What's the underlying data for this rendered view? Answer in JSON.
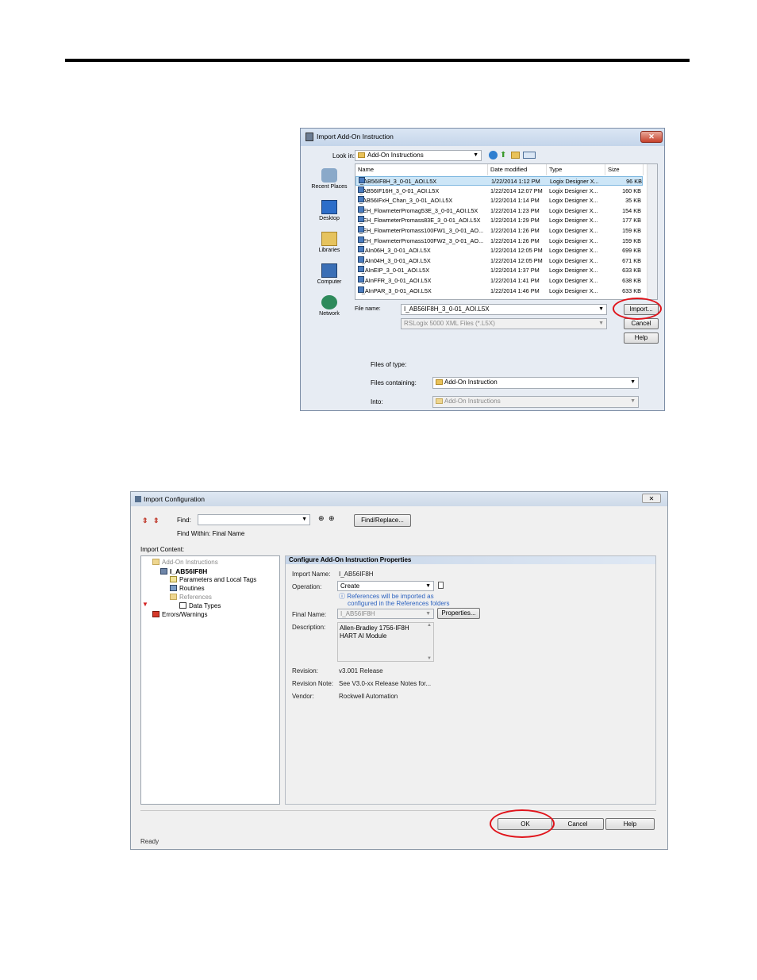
{
  "dialog1": {
    "title": "Import Add-On Instruction",
    "look_in_label": "Look in:",
    "look_in_value": "Add-On Instructions",
    "places": [
      {
        "label": "Recent Places",
        "icon": "recent-places-icon"
      },
      {
        "label": "Desktop",
        "icon": "desktop-icon"
      },
      {
        "label": "Libraries",
        "icon": "libraries-icon"
      },
      {
        "label": "Computer",
        "icon": "computer-icon"
      },
      {
        "label": "Network",
        "icon": "network-icon"
      }
    ],
    "columns": [
      "Name",
      "Date modified",
      "Type",
      "Size"
    ],
    "files": [
      {
        "name": "I_AB56IF8H_3_0-01_AOI.L5X",
        "date": "1/22/2014 1:12 PM",
        "type": "Logix Designer X...",
        "size": "96 KB"
      },
      {
        "name": "I_AB56IF16H_3_0-01_AOI.L5X",
        "date": "1/22/2014 12:07 PM",
        "type": "Logix Designer X...",
        "size": "160 KB"
      },
      {
        "name": "I_AB56IFxH_Chan_3_0-01_AOI.L5X",
        "date": "1/22/2014 1:14 PM",
        "type": "Logix Designer X...",
        "size": "35 KB"
      },
      {
        "name": "I_EH_FlowmeterPromag53E_3_0-01_AOI.L5X",
        "date": "1/22/2014 1:23 PM",
        "type": "Logix Designer X...",
        "size": "154 KB"
      },
      {
        "name": "I_EH_FlowmeterPromass83E_3_0-01_AOI.L5X",
        "date": "1/22/2014 1:29 PM",
        "type": "Logix Designer X...",
        "size": "177 KB"
      },
      {
        "name": "I_EH_FlowmeterPromass100FW1_3_0-01_AO...",
        "date": "1/22/2014 1:26 PM",
        "type": "Logix Designer X...",
        "size": "159 KB"
      },
      {
        "name": "I_EH_FlowmeterPromass100FW2_3_0-01_AO...",
        "date": "1/22/2014 1:26 PM",
        "type": "Logix Designer X...",
        "size": "159 KB"
      },
      {
        "name": "P_AIn06H_3_0-01_AOI.L5X",
        "date": "1/22/2014 12:05 PM",
        "type": "Logix Designer X...",
        "size": "699 KB"
      },
      {
        "name": "P_AIn04H_3_0-01_AOI.L5X",
        "date": "1/22/2014 12:05 PM",
        "type": "Logix Designer X...",
        "size": "671 KB"
      },
      {
        "name": "P_AInEIP_3_0-01_AOI.L5X",
        "date": "1/22/2014 1:37 PM",
        "type": "Logix Designer X...",
        "size": "633 KB"
      },
      {
        "name": "P_AInFFR_3_0-01_AOI.L5X",
        "date": "1/22/2014 1:41 PM",
        "type": "Logix Designer X...",
        "size": "638 KB"
      },
      {
        "name": "P_AInPAR_3_0-01_AOI.L5X",
        "date": "1/22/2014 1:46 PM",
        "type": "Logix Designer X...",
        "size": "633 KB"
      }
    ],
    "file_name_label": "File name:",
    "file_name_value": "I_AB56IF8H_3_0-01_AOI.L5X",
    "file_type_value": "RSLogix 5000 XML Files (*.L5X)",
    "import_label": "Import...",
    "cancel_label": "Cancel",
    "help_label": "Help",
    "files_of_type_label": "Files of type:",
    "files_containing_label": "Files containing:",
    "files_containing_value": "Add-On Instruction",
    "into_label": "Into:",
    "into_value": "Add-On Instructions"
  },
  "dialog2": {
    "title": "Import Configuration",
    "find_label": "Find:",
    "find_value": "",
    "find_replace_label": "Find/Replace...",
    "find_within": "Find Within: Final Name",
    "import_content_label": "Import Content:",
    "tree": {
      "root": "Add-On Instructions",
      "aoi": "I_AB56IF8H",
      "params": "Parameters and Local Tags",
      "routines": "Routines",
      "references": "References",
      "data_types": "Data Types",
      "errors": "Errors/Warnings"
    },
    "panel_title": "Configure Add-On Instruction Properties",
    "import_name_label": "Import Name:",
    "import_name_value": "I_AB56IF8H",
    "operation_label": "Operation:",
    "operation_value": "Create",
    "info_line1": "References will be imported as",
    "info_line2": "configured in the References folders",
    "final_name_label": "Final Name:",
    "final_name_value": "I_AB56IF8H",
    "properties_label": "Properties...",
    "description_label": "Description:",
    "description_line1": "Allen-Bradley 1756-IF8H",
    "description_line2": "HART AI Module",
    "revision_label": "Revision:",
    "revision_value": "v3.001 Release",
    "revision_note_label": "Revision Note:",
    "revision_note_value": "See V3.0-xx Release Notes for...",
    "vendor_label": "Vendor:",
    "vendor_value": "Rockwell Automation",
    "ok_label": "OK",
    "cancel_label": "Cancel",
    "help_label": "Help",
    "status": "Ready"
  },
  "colors": {
    "highlight": "#e0141b",
    "selection": "#cde6f7",
    "info_text": "#2d63c0"
  }
}
